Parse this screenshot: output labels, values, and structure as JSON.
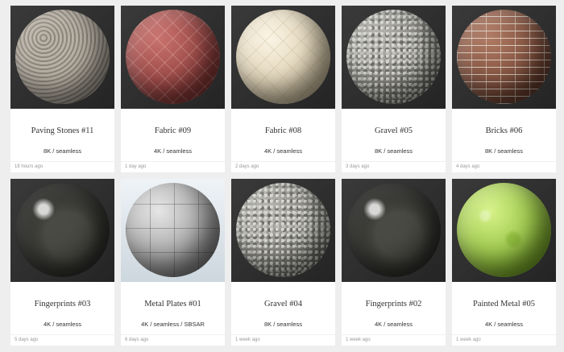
{
  "materials": [
    {
      "name": "Paving Stones #11",
      "meta": "8K / seamless",
      "time": "18 hours ago",
      "look": "m-paving",
      "icon": "paving-stones-sphere"
    },
    {
      "name": "Fabric #09",
      "meta": "4K / seamless",
      "time": "1 day ago",
      "look": "m-fabric9",
      "icon": "fabric-sphere"
    },
    {
      "name": "Fabric #08",
      "meta": "4K / seamless",
      "time": "2 days ago",
      "look": "m-fabric8",
      "icon": "fabric-sphere"
    },
    {
      "name": "Gravel #05",
      "meta": "8K / seamless",
      "time": "3 days ago",
      "look": "m-gravel",
      "icon": "gravel-sphere"
    },
    {
      "name": "Bricks #06",
      "meta": "8K / seamless",
      "time": "4 days ago",
      "look": "m-bricks",
      "icon": "bricks-sphere"
    },
    {
      "name": "Fingerprints #03",
      "meta": "4K / seamless",
      "time": "5 days ago",
      "look": "m-fingerprint",
      "icon": "fingerprints-sphere"
    },
    {
      "name": "Metal Plates #01",
      "meta": "4K / seamless / SBSAR",
      "time": "6 days ago",
      "look": "m-metalplates",
      "icon": "metal-plates-sphere",
      "light_bg": true
    },
    {
      "name": "Gravel #04",
      "meta": "8K / seamless",
      "time": "1 week ago",
      "look": "m-gravel",
      "icon": "gravel-sphere"
    },
    {
      "name": "Fingerprints #02",
      "meta": "4K / seamless",
      "time": "1 week ago",
      "look": "m-fingerprint",
      "icon": "fingerprints-sphere"
    },
    {
      "name": "Painted Metal #05",
      "meta": "4K / seamless",
      "time": "1 week ago",
      "look": "m-paintedmetal",
      "icon": "painted-metal-sphere"
    }
  ]
}
